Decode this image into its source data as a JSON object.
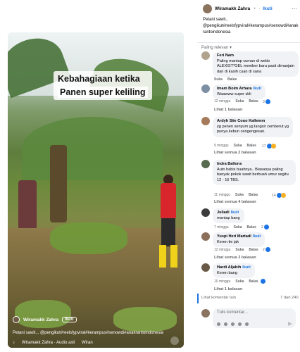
{
  "video": {
    "caption_line1": "Kebahagiaan ketika",
    "caption_line2": "Panen super keliling",
    "author": "Wiramakk Zahra",
    "follow": "Ikuti",
    "description": "Petani sawit... @pengikut#reelsfypviral#kerampus#senowdi#anakrantoindonesia",
    "music": "Wiramakk Zahra · Audio asli",
    "music2": "Wiran"
  },
  "header": {
    "name": "Wiramakk Zahra",
    "follow": "Ikuti",
    "post_text_1": "Petani sawit..",
    "post_text_2": "@pengikut#reelsfypviral#kerampus#senowdi#anakrantoindonesia"
  },
  "sort_label": "Paling relevan",
  "actions": {
    "like": "Suka",
    "reply": "Balas"
  },
  "comments": [
    {
      "name": "Feri Nam",
      "text": "Paling mantap cuman di webb ALEXIST*GEL member baru pasti dimanjain dan di kasih cuan di sana",
      "time": "",
      "author": ""
    },
    {
      "name": "Imam Boim Arhara",
      "author": "Ikuti",
      "text": "Waawww super skli",
      "time": "12 minggu",
      "reactions": "3",
      "replies": "Lihat 1 balasan"
    },
    {
      "name": "Ardyh Siie Couo Kallemm",
      "text": "yg penen senyum yg langsir cemberut yg punya kebun cengengesan.",
      "time": "9 minggu",
      "reactions": "17",
      "replies": "Lihat semua 2 balasan"
    },
    {
      "name": "Indra Ballons",
      "text": "Auto habis buahnya.. Biasanya paling banyak pokok sawit berbuah umur segitu 12 - 16 TBS.",
      "time": "11 minggu",
      "reactions": "14",
      "replies": "Lihat semua 4 balasan"
    },
    {
      "name": "Juliadi",
      "author": "Ikuti",
      "text": "mantap bang",
      "time": "7 minggu",
      "reactions": "2"
    },
    {
      "name": "Yuspi Heri Martadi",
      "author": "Ikuti",
      "text": "Keren tie jak",
      "time": "12 minggu",
      "reactions": "2",
      "replies": "Lihat semua 3 balasan"
    },
    {
      "name": "Hardi Aljabih",
      "author": "Ikuti",
      "text": "Keren bang",
      "time": "10 minggu",
      "reactions": "",
      "replies": "Lihat 1 balasan"
    }
  ],
  "more_comments": "Lihat komentar lain",
  "count": "7 dari 240",
  "input_placeholder": "Tulis komentar..."
}
